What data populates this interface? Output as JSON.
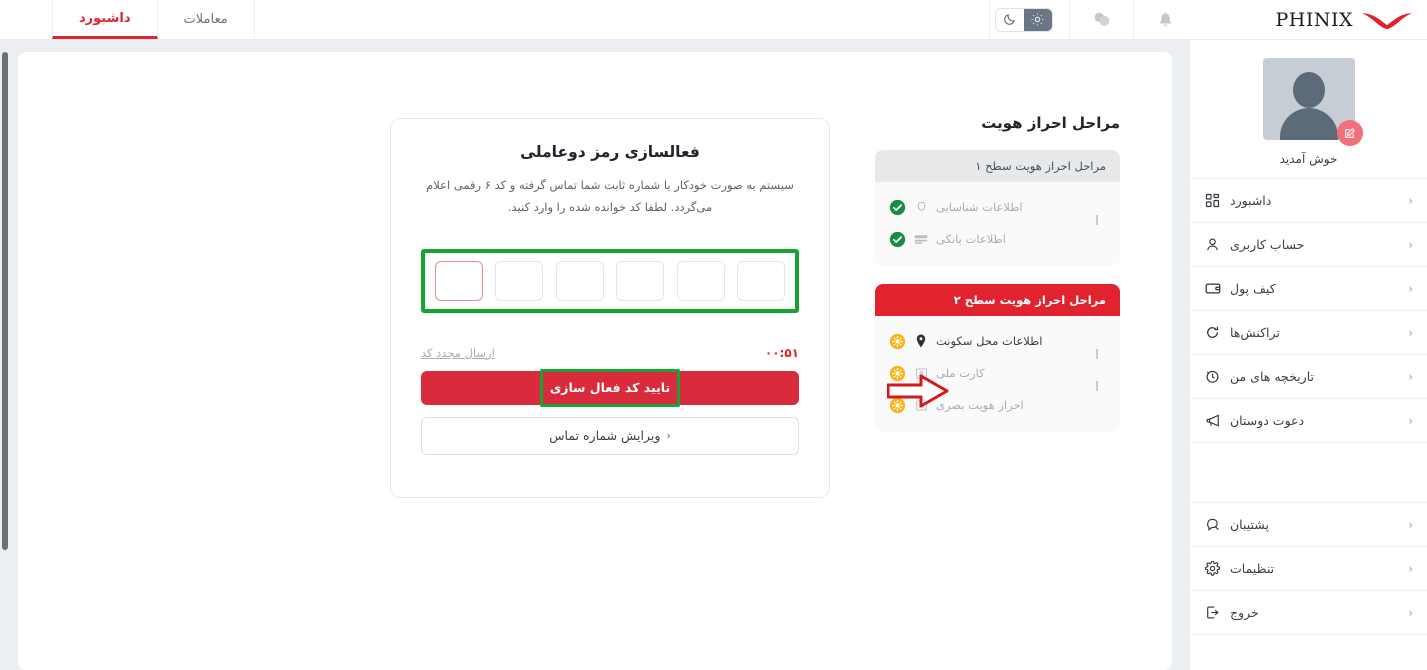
{
  "brand": {
    "name": "PHINIX",
    "accent": "#e0232e"
  },
  "header": {
    "icons": {
      "bell": "bell-icon",
      "chat": "chat-icon",
      "sun": "sun-icon",
      "moon": "moon-icon"
    },
    "tabs": [
      {
        "label": "معاملات",
        "active": false
      },
      {
        "label": "داشبورد",
        "active": true
      }
    ]
  },
  "sidebar": {
    "welcome": "خوش آمدید",
    "edit_badge": "edit-pencil-icon",
    "items": [
      {
        "label": "داشبورد",
        "icon": "grid-icon"
      },
      {
        "label": "حساب کاربری",
        "icon": "user-icon"
      },
      {
        "label": "کیف پول",
        "icon": "wallet-icon"
      },
      {
        "label": "تراکنش‌ها",
        "icon": "refresh-icon"
      },
      {
        "label": "تاریخچه های من",
        "icon": "history-icon"
      },
      {
        "label": "دعوت دوستان",
        "icon": "megaphone-icon"
      },
      {
        "label": "پشتیبان",
        "icon": "support-chat-icon"
      },
      {
        "label": "تنظیمات",
        "icon": "gear-icon"
      },
      {
        "label": "خروج",
        "icon": "logout-icon"
      }
    ],
    "chevron": "‹"
  },
  "otp_card": {
    "title": "فعالسازی رمز دوعاملی",
    "description": "سیستم به صورت خودکار با شماره ثابت شما تماس گرفته و کد ۶ رقمی اعلام می‌گردد. لطفا کد خوانده شده را وارد کنید.",
    "cells": [
      "",
      "",
      "",
      "",
      "",
      ""
    ],
    "focused_index": 0,
    "resend_label": "ارسال مجدد کد",
    "timer": "۰۰:۵۱",
    "confirm_label": "تایید کد فعال سازی",
    "edit_phone_label": "ویرایش شماره تماس",
    "edit_phone_chevron": "‹"
  },
  "verification": {
    "title": "مراحل احراز هویت",
    "levels": [
      {
        "header": "مراحل احراز هویت سطح ۱",
        "state": "done",
        "steps": [
          {
            "label": "اطلاعات شناسایی",
            "icon": "id-head-icon",
            "status": "done"
          },
          {
            "label": "اطلاعات بانکی",
            "icon": "bank-card-icon",
            "status": "done"
          }
        ]
      },
      {
        "header": "مراحل احراز هویت سطح ۲",
        "state": "pending",
        "steps": [
          {
            "label": "اطلاعات محل سکونت",
            "icon": "location-pin-icon",
            "status": "pending",
            "highlighted": true
          },
          {
            "label": "کارت ملی",
            "icon": "id-card-icon",
            "status": "pending",
            "highlighted": false
          },
          {
            "label": "احراز هویت بصری",
            "icon": "id-card-icon",
            "status": "pending",
            "highlighted": false
          }
        ]
      }
    ]
  },
  "annotations": {
    "otp_box_highlight_color": "#16a532",
    "confirm_button_highlight_color": "#16a532",
    "arrow_color": "#d3191f",
    "arrow_target": "اطلاعات محل سکونت"
  }
}
